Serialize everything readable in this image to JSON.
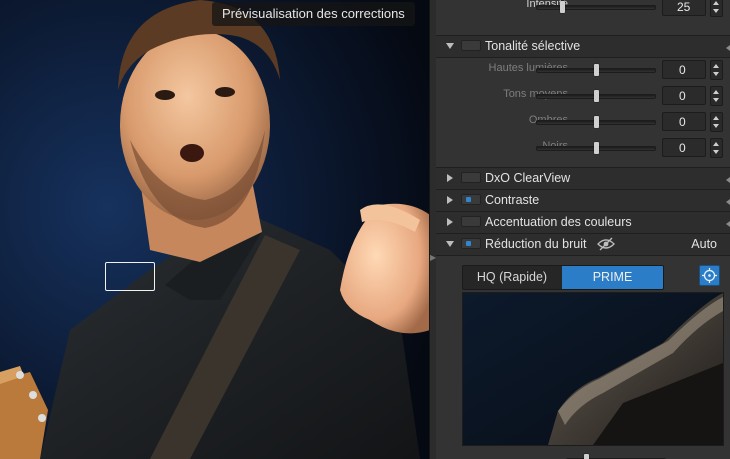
{
  "viewer": {
    "preview_label": "Prévisualisation des corrections"
  },
  "panel": {
    "intensity": {
      "label": "Intensité",
      "value": "25",
      "level": 25
    },
    "selective_tone": {
      "title": "Tonalité sélective",
      "enabled": false,
      "expanded": true,
      "sliders": [
        {
          "label": "Hautes lumières",
          "value": "0",
          "level": 0
        },
        {
          "label": "Tons moyens",
          "value": "0",
          "level": 0
        },
        {
          "label": "Ombres",
          "value": "0",
          "level": 0
        },
        {
          "label": "Noirs",
          "value": "0",
          "level": 0
        }
      ]
    },
    "sections": [
      {
        "title": "DxO ClearView",
        "enabled": false,
        "expanded": false
      },
      {
        "title": "Contraste",
        "enabled": true,
        "expanded": false
      },
      {
        "title": "Accentuation des couleurs",
        "enabled": false,
        "expanded": false
      }
    ],
    "noise_reduction": {
      "title": "Réduction du bruit",
      "enabled": true,
      "expanded": true,
      "eye_icon": "eye-slash-icon",
      "auto_label": "Auto",
      "modes": [
        {
          "label": "HQ (Rapide)",
          "selected": false
        },
        {
          "label": "PRIME",
          "selected": true
        }
      ],
      "target_icon": "crosshair-icon"
    }
  },
  "colors": {
    "accent": "#2a7dc6",
    "panel_bg": "#333333",
    "section_bg": "#2d2d2d",
    "led": "#2f87d4"
  }
}
